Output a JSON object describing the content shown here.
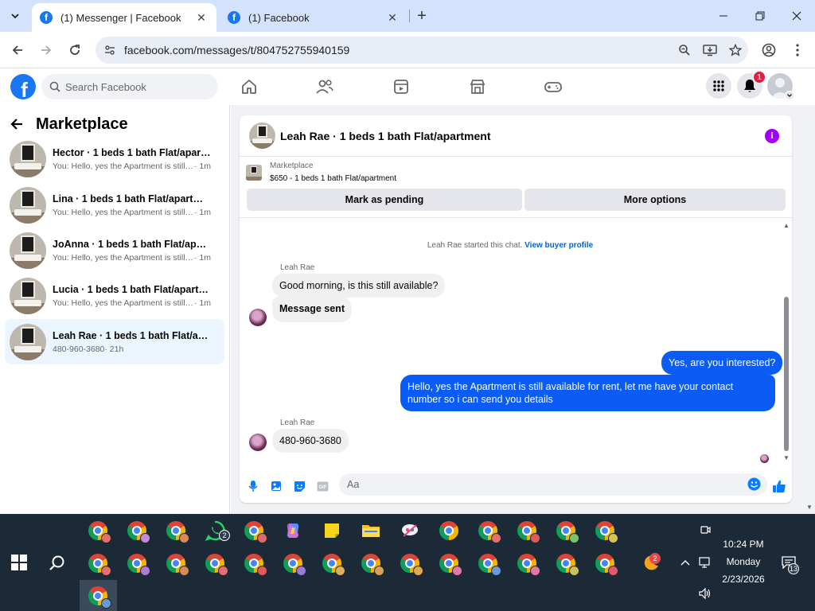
{
  "browser": {
    "tabs": [
      {
        "title": "(1) Messenger | Facebook",
        "active": true
      },
      {
        "title": "(1) Facebook",
        "active": false
      }
    ],
    "url": "facebook.com/messages/t/804752755940159"
  },
  "fb_header": {
    "search_placeholder": "Search Facebook",
    "notification_count": "1",
    "brand_color": "#1877f2"
  },
  "sidebar": {
    "title": "Marketplace",
    "conversations": [
      {
        "name": "Hector · 1 beds 1 bath Flat/apartm...",
        "preview": "You: Hello, yes the Apartment is still a...",
        "time": "· 1m",
        "active": false
      },
      {
        "name": "Lina · 1 beds 1 bath Flat/apartment",
        "preview": "You: Hello, yes the Apartment is still a...",
        "time": "· 1m",
        "active": false
      },
      {
        "name": "JoAnna · 1 beds 1 bath Flat/apartm...",
        "preview": "You: Hello, yes the Apartment is still a...",
        "time": "· 1m",
        "active": false
      },
      {
        "name": "Lucia · 1 beds 1 bath Flat/apartment",
        "preview": "You: Hello, yes the Apartment is still a...",
        "time": "· 1m",
        "active": false
      },
      {
        "name": "Leah Rae · 1 beds 1 bath Flat/apart...",
        "preview": "480-960-3680",
        "time": " · 21h",
        "active": true
      }
    ]
  },
  "chat": {
    "title": "Leah Rae · 1 beds 1 bath Flat/apartment",
    "listing_source": "Marketplace",
    "listing_detail": "$650 - 1 beds 1 bath Flat/apartment",
    "mark_pending_label": "Mark as pending",
    "more_options_label": "More options",
    "system_text": "Leah Rae started this chat.",
    "system_link": "View buyer profile",
    "sender_name": "Leah Rae",
    "messages": [
      {
        "from": "them",
        "text": "Good morning, is this still available?"
      },
      {
        "from": "them",
        "text": "Message sent"
      },
      {
        "from": "me",
        "text": "Yes, are you interested?"
      },
      {
        "from": "me",
        "text": "Hello, yes the Apartment is still available for rent, let me have your contact number so i can send you details"
      },
      {
        "from": "them",
        "text": "480-960-3680"
      }
    ],
    "composer_placeholder": "Aa",
    "outgoing_color": "#0a5cf5",
    "accent_color": "#a100ff"
  },
  "taskbar": {
    "whatsapp_badge": "2",
    "weather_badge": "2",
    "time": "10:24 PM",
    "day": "Monday",
    "date": "2/23/2026",
    "notification_count": "13"
  }
}
